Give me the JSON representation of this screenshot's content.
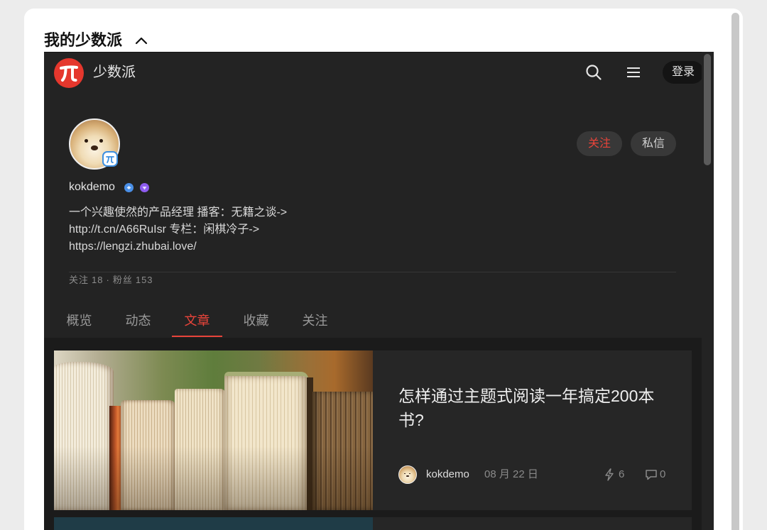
{
  "theme": {
    "accent": "#e8443a",
    "brand": "#e5372d"
  },
  "section": {
    "title": "我的少数派",
    "toggle_icon": "chevron-up-icon"
  },
  "site": {
    "name": "少数派",
    "logo_icon": "sspai-logo-icon",
    "login_label": "登录"
  },
  "header": {
    "search_icon": "search-icon",
    "menu_icon": "menu-icon"
  },
  "profile": {
    "username": "kokdemo",
    "badges": [
      "verified-badge-icon",
      "member-badge-icon"
    ],
    "bio_lines": [
      "一个兴趣使然的产品经理 播客：无籍之谈->",
      "http://t.cn/A66RuIsr 专栏：闲棋冷子->",
      "https://lengzi.zhubai.love/"
    ],
    "follow_label": "关注",
    "message_label": "私信",
    "stats": {
      "following_label": "关注",
      "following_count": "18",
      "separator": "·",
      "followers_label": "粉丝",
      "followers_count": "153"
    }
  },
  "tabs": [
    {
      "label": "概览",
      "active": false
    },
    {
      "label": "动态",
      "active": false
    },
    {
      "label": "文章",
      "active": true
    },
    {
      "label": "收藏",
      "active": false
    },
    {
      "label": "关注",
      "active": false
    }
  ],
  "articles": [
    {
      "title": "怎样通过主题式阅读一年搞定200本书?",
      "author": "kokdemo",
      "date": "08 月 22 日",
      "likes": "6",
      "comments": "0",
      "like_icon": "lightning-icon",
      "comment_icon": "comment-icon"
    }
  ]
}
